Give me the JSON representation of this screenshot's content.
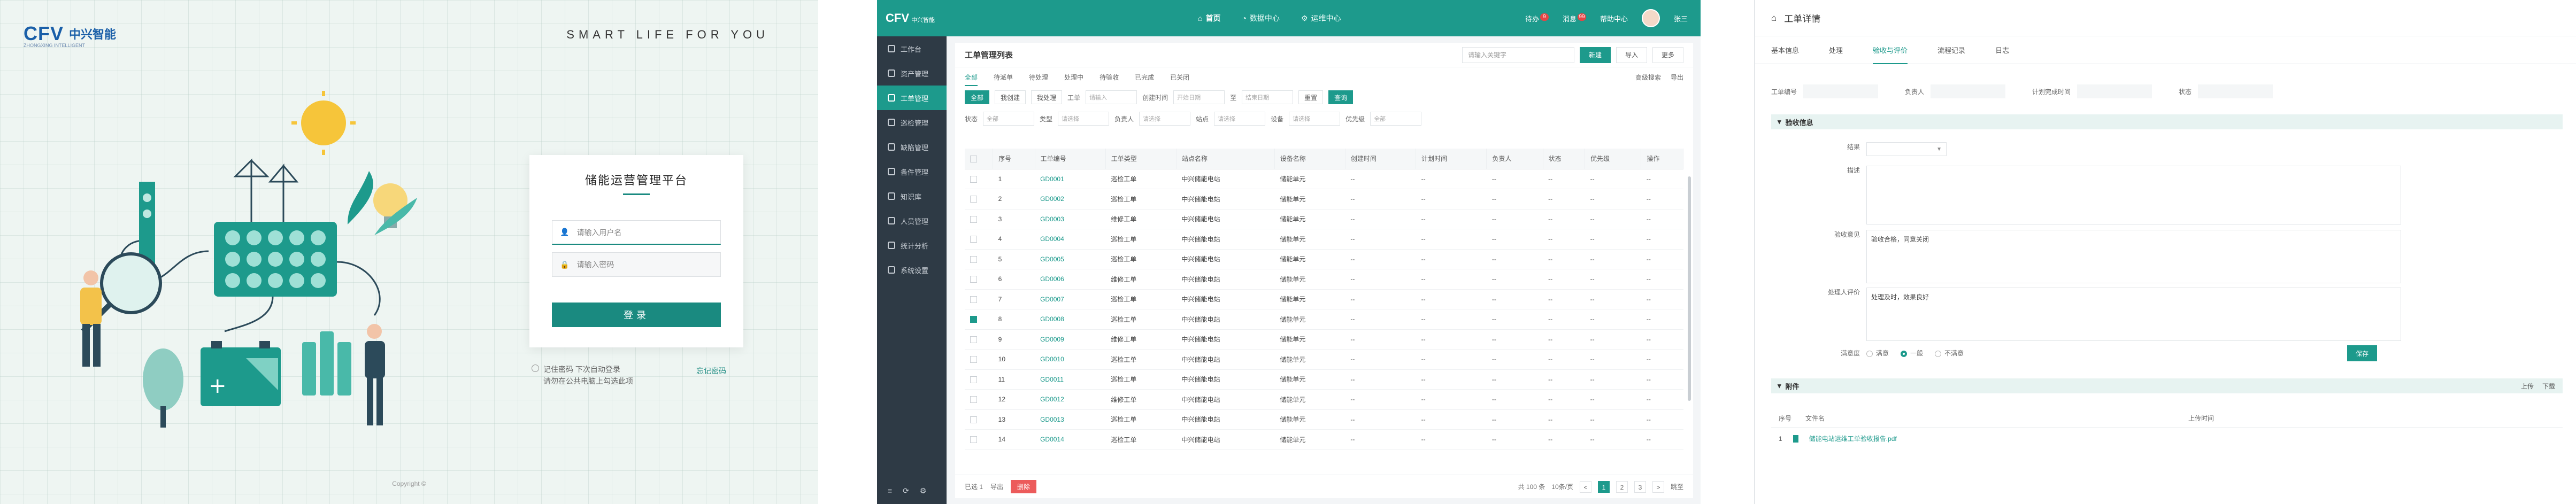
{
  "login": {
    "logo_mark": "CFV",
    "logo_name": "中兴智能",
    "logo_sub": "ZHONGXING INTELLIGENT",
    "slogan": "SMART LIFE FOR YOU",
    "card_title": "储能运营管理平台",
    "username_placeholder": "请输入用户名",
    "password_placeholder": "请输入密码",
    "login_button": "登录",
    "remember_line1": "记住密码  下次自动登录",
    "remember_line2": "请勿在公共电脑上勾选此项",
    "forgot": "忘记密码",
    "copyright": "Copyright ©"
  },
  "app": {
    "logo": "CFV",
    "logo_small": "中兴智能",
    "top_nav": [
      {
        "label": "首页",
        "active": true
      },
      {
        "label": "数据中心",
        "active": false
      },
      {
        "label": "运维中心",
        "active": false
      }
    ],
    "top_right": [
      {
        "label": "待办",
        "badge": "9"
      },
      {
        "label": "消息",
        "badge": "99"
      },
      {
        "label": "帮助中心",
        "badge": ""
      }
    ],
    "user_name": "张三",
    "sidebar": [
      {
        "label": "工作台",
        "active": false
      },
      {
        "label": "资产管理",
        "active": false
      },
      {
        "label": "工单管理",
        "active": true
      },
      {
        "label": "巡检管理",
        "active": false
      },
      {
        "label": "缺陷管理",
        "active": false
      },
      {
        "label": "备件管理",
        "active": false
      },
      {
        "label": "知识库",
        "active": false
      },
      {
        "label": "人员管理",
        "active": false
      },
      {
        "label": "统计分析",
        "active": false
      },
      {
        "label": "系统设置",
        "active": false
      }
    ],
    "sidebar_footer": [
      "≡",
      "⟳",
      "⚙"
    ]
  },
  "list": {
    "title": "工单管理列表",
    "search_placeholder": "请输入关键字",
    "btn_new": "新建",
    "btn_import": "导入",
    "btn_more": "更多",
    "tabs": [
      "全部",
      "待派单",
      "待处理",
      "处理中",
      "待验收",
      "已完成",
      "已关闭"
    ],
    "tabs_right": [
      "高级搜索",
      "导出"
    ],
    "filter_row1": {
      "chips": [
        "全部",
        "我创建",
        "我处理"
      ],
      "labels": [
        "工单",
        "创建时间",
        "至"
      ],
      "inputs": [
        "请输入",
        "开始日期",
        "结束日期"
      ],
      "extra": [
        "重置",
        "查询"
      ]
    },
    "filter_row2": {
      "labels": [
        "状态",
        "类型",
        "负责人",
        "站点",
        "设备",
        "优先级"
      ],
      "inputs": [
        "全部",
        "请选择",
        "请选择",
        "请选择",
        "请选择",
        "全部"
      ]
    },
    "columns": [
      "",
      "序号",
      "工单编号",
      "工单类型",
      "站点名称",
      "设备名称",
      "创建时间",
      "计划时间",
      "负责人",
      "状态",
      "优先级",
      "操作"
    ],
    "rows": [
      {
        "no": "1",
        "code": "GD0001",
        "type": "巡检工单",
        "site": "中兴储能电站",
        "dev": "储能单元",
        "checked": false
      },
      {
        "no": "2",
        "code": "GD0002",
        "type": "巡检工单",
        "site": "中兴储能电站",
        "dev": "储能单元",
        "checked": false
      },
      {
        "no": "3",
        "code": "GD0003",
        "type": "维修工单",
        "site": "中兴储能电站",
        "dev": "储能单元",
        "checked": false
      },
      {
        "no": "4",
        "code": "GD0004",
        "type": "巡检工单",
        "site": "中兴储能电站",
        "dev": "储能单元",
        "checked": false
      },
      {
        "no": "5",
        "code": "GD0005",
        "type": "巡检工单",
        "site": "中兴储能电站",
        "dev": "储能单元",
        "checked": false
      },
      {
        "no": "6",
        "code": "GD0006",
        "type": "维修工单",
        "site": "中兴储能电站",
        "dev": "储能单元",
        "checked": false
      },
      {
        "no": "7",
        "code": "GD0007",
        "type": "巡检工单",
        "site": "中兴储能电站",
        "dev": "储能单元",
        "checked": false
      },
      {
        "no": "8",
        "code": "GD0008",
        "type": "巡检工单",
        "site": "中兴储能电站",
        "dev": "储能单元",
        "checked": true
      },
      {
        "no": "9",
        "code": "GD0009",
        "type": "维修工单",
        "site": "中兴储能电站",
        "dev": "储能单元",
        "checked": false
      },
      {
        "no": "10",
        "code": "GD0010",
        "type": "巡检工单",
        "site": "中兴储能电站",
        "dev": "储能单元",
        "checked": false
      },
      {
        "no": "11",
        "code": "GD0011",
        "type": "巡检工单",
        "site": "中兴储能电站",
        "dev": "储能单元",
        "checked": false
      },
      {
        "no": "12",
        "code": "GD0012",
        "type": "维修工单",
        "site": "中兴储能电站",
        "dev": "储能单元",
        "checked": false
      },
      {
        "no": "13",
        "code": "GD0013",
        "type": "巡检工单",
        "site": "中兴储能电站",
        "dev": "储能单元",
        "checked": false
      },
      {
        "no": "14",
        "code": "GD0014",
        "type": "巡检工单",
        "site": "中兴储能电站",
        "dev": "储能单元",
        "checked": false
      }
    ],
    "cell_placeholder": "--",
    "footer_select": "已选 1",
    "footer_export": "导出",
    "footer_delete": "删除",
    "pager_total": "共 100 条",
    "pager_pages": [
      "<",
      "1",
      "2",
      "3",
      ">"
    ],
    "pager_active": "1",
    "pager_size": "10条/页",
    "pager_goto": "跳至"
  },
  "detail": {
    "title": "工单详情",
    "tabs": [
      {
        "label": "基本信息",
        "active": false
      },
      {
        "label": "处理",
        "active": false
      },
      {
        "label": "验收与评价",
        "active": true
      },
      {
        "label": "流程记录",
        "active": false
      },
      {
        "label": "日志",
        "active": false
      }
    ],
    "kv": [
      "工单编号",
      "负责人",
      "计划完成时间",
      "状态"
    ],
    "section_accept": "验收信息",
    "accept_select_label": "结果",
    "row_remark_label": "描述",
    "row_opinion_label": "验收意见",
    "row_opinion_value": "验收合格，同意关闭",
    "row_eval_label": "处理人评价",
    "row_eval_value": "处理及时，效果良好",
    "rating_label": "满意度",
    "rating_options": [
      "满意",
      "一般",
      "不满意"
    ],
    "rating_active": "一般",
    "save_button": "保存",
    "section_attach": "附件",
    "attach_actions": [
      "上传",
      "下载"
    ],
    "attach_cols": [
      "序号",
      "文件名",
      "上传时间"
    ],
    "attach_rows": [
      {
        "no": "1",
        "name": "储能电站运维工单验收报告.pdf"
      }
    ]
  }
}
